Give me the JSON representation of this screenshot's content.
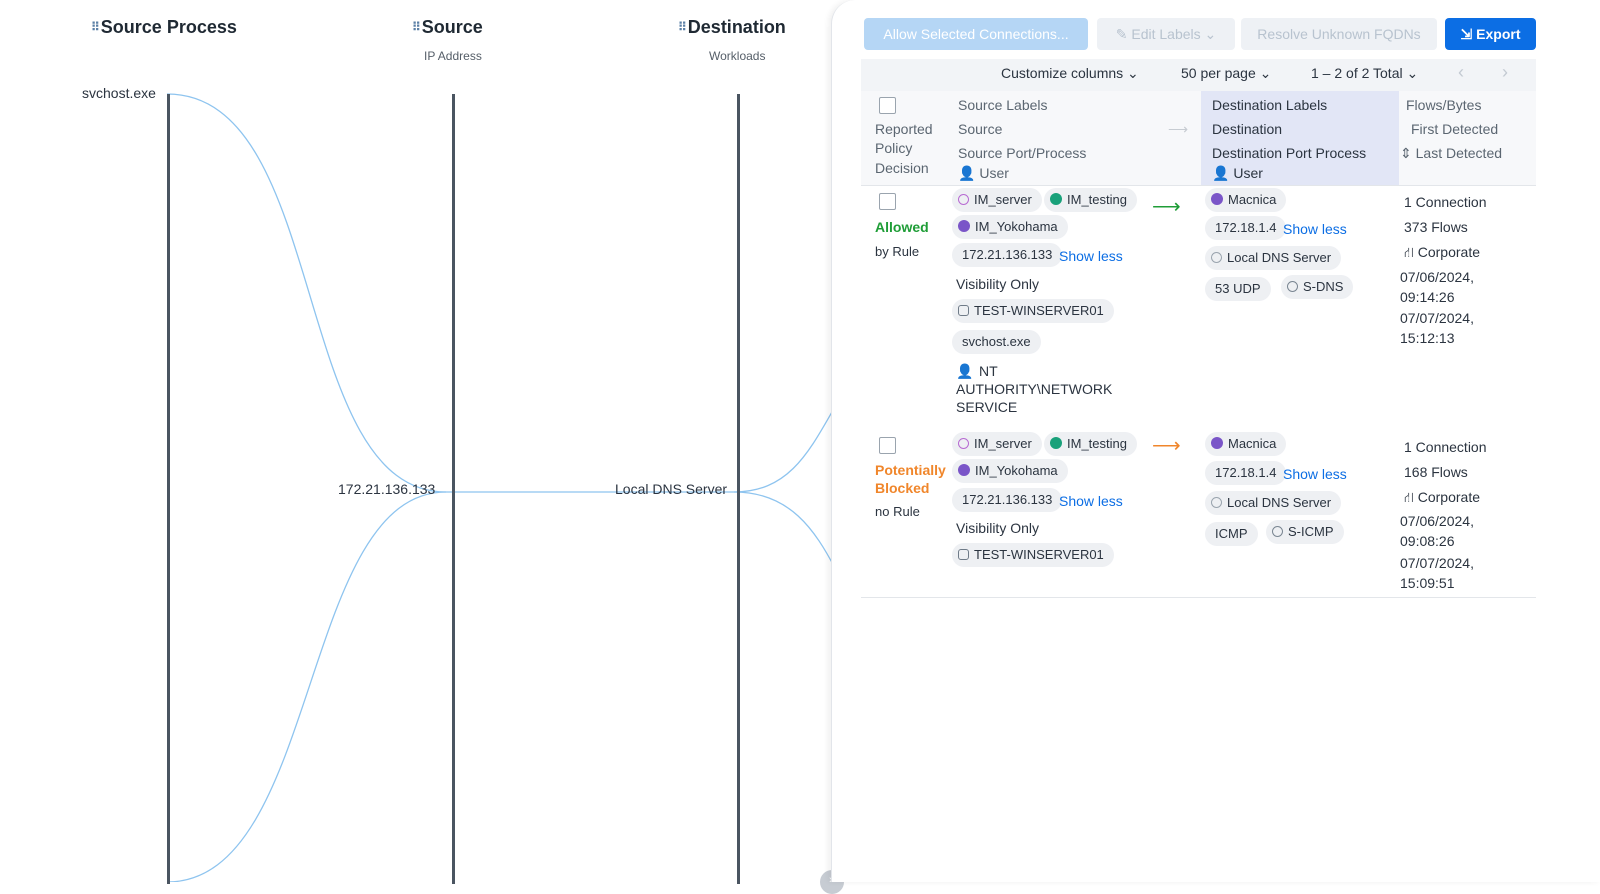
{
  "flow": {
    "columns": [
      {
        "title": "Source Process",
        "subtitle": ""
      },
      {
        "title": "Source",
        "subtitle": "IP Address"
      },
      {
        "title": "Destination",
        "subtitle": "Workloads"
      }
    ],
    "nodes": {
      "process": "svchost.exe",
      "source_ip": "172.21.136.133",
      "destination": "Local DNS Server"
    },
    "link_color": "#8ec4ef",
    "collapse_glyph": "»"
  },
  "actions": {
    "allow": "Allow Selected Connections...",
    "edit_labels": "Edit Labels",
    "resolve": "Resolve Unknown FQDNs",
    "export": "Export"
  },
  "toolbar": {
    "customize": "Customize columns",
    "per_page": "50 per page",
    "pagination": "1 – 2 of 2 Total"
  },
  "table_header": {
    "decision": [
      "Reported",
      "Policy",
      "Decision"
    ],
    "source": [
      "Source Labels",
      "Source",
      "Source Port/Process",
      "User"
    ],
    "destination": [
      "Destination Labels",
      "Destination",
      "Destination Port Process",
      "User"
    ],
    "metrics": [
      "Flows/Bytes",
      "First Detected",
      "Last Detected"
    ]
  },
  "rows": [
    {
      "decision": "Allowed",
      "decision_sub": "by Rule",
      "src_labels": [
        "IM_server",
        "IM_testing",
        "IM_Yokohama"
      ],
      "src_ip": "172.21.136.133",
      "show_less": "Show less",
      "visibility": "Visibility Only",
      "workload": "TEST-WINSERVER01",
      "process": "svchost.exe",
      "user": "NT AUTHORITY\\NETWORK SERVICE",
      "user_lines": [
        "NT",
        "AUTHORITY\\NETWORK",
        "SERVICE"
      ],
      "dst_label": "Macnica",
      "dst_ip": "172.18.1.4",
      "dst_workload": "Local DNS Server",
      "dst_port": "53 UDP",
      "dst_service": "S-DNS",
      "connections": "1 Connection",
      "flows": "373 Flows",
      "network": "Corporate",
      "first_date": "07/06/2024,",
      "first_time": "09:14:26",
      "last_date": "07/07/2024,",
      "last_time": "15:12:13",
      "arrow_color": "#1f9d37"
    },
    {
      "decision_line1": "Potentially",
      "decision_line2": "Blocked",
      "decision_sub": "no Rule",
      "src_labels": [
        "IM_server",
        "IM_testing",
        "IM_Yokohama"
      ],
      "src_ip": "172.21.136.133",
      "show_less": "Show less",
      "visibility": "Visibility Only",
      "workload": "TEST-WINSERVER01",
      "dst_label": "Macnica",
      "dst_ip": "172.18.1.4",
      "dst_workload": "Local DNS Server",
      "dst_port": "ICMP",
      "dst_service": "S-ICMP",
      "connections": "1 Connection",
      "flows": "168 Flows",
      "network": "Corporate",
      "first_date": "07/06/2024,",
      "first_time": "09:08:26",
      "last_date": "07/07/2024,",
      "last_time": "15:09:51",
      "arrow_color": "#f0862b"
    }
  ]
}
